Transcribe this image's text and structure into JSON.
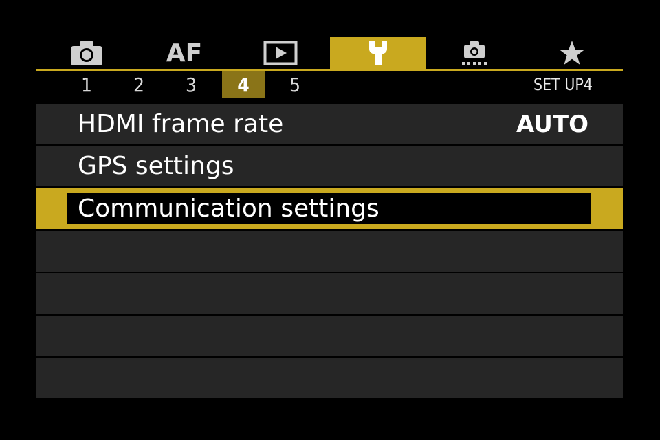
{
  "tabs": [
    {
      "id": "shooting",
      "icon": "camera-icon"
    },
    {
      "id": "af",
      "label": "AF"
    },
    {
      "id": "playback",
      "icon": "playback-icon"
    },
    {
      "id": "setup",
      "icon": "wrench-icon",
      "active": true
    },
    {
      "id": "custom",
      "icon": "custom-functions-icon"
    },
    {
      "id": "mymenu",
      "icon": "star-icon"
    }
  ],
  "pages": {
    "numbers": [
      "1",
      "2",
      "3",
      "4",
      "5"
    ],
    "active": "4",
    "title": "SET UP4"
  },
  "menu": {
    "items": [
      {
        "label": "HDMI frame rate",
        "value": "AUTO"
      },
      {
        "label": "GPS settings",
        "value": ""
      },
      {
        "label": "Communication settings",
        "value": "",
        "selected": true
      },
      {
        "label": "",
        "value": ""
      },
      {
        "label": "",
        "value": ""
      },
      {
        "label": "",
        "value": ""
      },
      {
        "label": "",
        "value": ""
      }
    ]
  },
  "colors": {
    "accent": "#c9a91f",
    "active_page": "#8a7418",
    "row_bg": "#262626",
    "background": "#000000"
  }
}
